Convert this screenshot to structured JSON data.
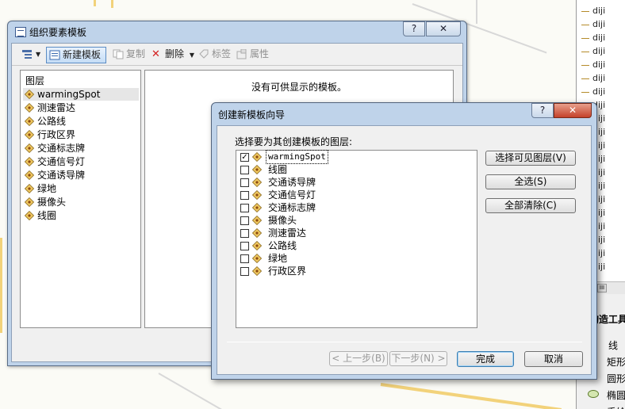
{
  "right_panel": {
    "items": [
      "diji",
      "diji",
      "diji",
      "diji",
      "diji",
      "diji",
      "diji",
      "diji",
      "diji",
      "diji",
      "diji",
      "diji",
      "diji",
      "diji",
      "diji",
      "diji",
      "diji",
      "diji",
      "diji",
      "diji"
    ],
    "scroll_glyph": "III",
    "construct_title": "构造工具",
    "tools": [
      {
        "label": "线",
        "icon": "line-tool-icon"
      },
      {
        "label": "矩形",
        "icon": "rectangle-tool-icon"
      },
      {
        "label": "圆形",
        "icon": "circle-tool-icon"
      },
      {
        "label": "椭圆",
        "icon": "ellipse-tool-icon"
      },
      {
        "label": "手绘",
        "icon": "freehand-tool-icon"
      }
    ]
  },
  "organize_window": {
    "title": "组织要素模板",
    "help_label": "?",
    "close_label": "✕",
    "toolbar": {
      "new_template": "新建模板",
      "copy": "复制",
      "delete": "删除",
      "tag": "标签",
      "properties": "属性"
    },
    "layers_header": "图层",
    "layers": [
      "warmingSpot",
      "测速雷达",
      "公路线",
      "行政区界",
      "交通标志牌",
      "交通信号灯",
      "交通诱导牌",
      "绿地",
      "摄像头",
      "线圈"
    ],
    "empty_message": "没有可供显示的模板。"
  },
  "wizard": {
    "title": "创建新模板向导",
    "help_label": "?",
    "close_label": "✕",
    "prompt": "选择要为其创建模板的图层:",
    "layers": [
      {
        "label": "warmingSpot",
        "checked": true
      },
      {
        "label": "线圈",
        "checked": false
      },
      {
        "label": "交通诱导牌",
        "checked": false
      },
      {
        "label": "交通信号灯",
        "checked": false
      },
      {
        "label": "交通标志牌",
        "checked": false
      },
      {
        "label": "摄像头",
        "checked": false
      },
      {
        "label": "测速雷达",
        "checked": false
      },
      {
        "label": "公路线",
        "checked": false
      },
      {
        "label": "绿地",
        "checked": false
      },
      {
        "label": "行政区界",
        "checked": false
      }
    ],
    "select_visible": "选择可见图层(V)",
    "select_all": "全选(S)",
    "clear_all": "全部清除(C)",
    "back": "< 上一步(B)",
    "next": "下一步(N) >",
    "finish": "完成",
    "cancel": "取消"
  }
}
